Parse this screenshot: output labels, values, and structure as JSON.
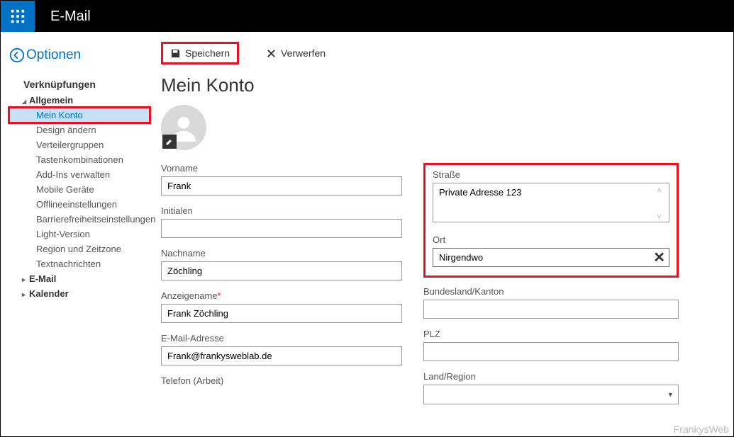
{
  "topbar": {
    "app_title": "E-Mail"
  },
  "back_label": "Optionen",
  "nav": {
    "heading": "Verknüpfungen",
    "group_allgemein": "Allgemein",
    "items_allgemein": {
      "mein_konto": "Mein Konto",
      "design": "Design ändern",
      "verteiler": "Verteilergruppen",
      "tasten": "Tastenkombinationen",
      "addins": "Add-Ins verwalten",
      "mobile": "Mobile Geräte",
      "offline": "Offlineeinstellungen",
      "barriere": "Barrierefreiheitseinstellungen",
      "light": "Light-Version",
      "region": "Region und Zeitzone",
      "text": "Textnachrichten"
    },
    "group_email": "E-Mail",
    "group_kalender": "Kalender"
  },
  "toolbar": {
    "save": "Speichern",
    "discard": "Verwerfen"
  },
  "page_title": "Mein Konto",
  "form": {
    "left": {
      "vorname_label": "Vorname",
      "vorname_value": "Frank",
      "initialen_label": "Initialen",
      "initialen_value": "",
      "nachname_label": "Nachname",
      "nachname_value": "Zöchling",
      "anzeigename_label": "Anzeigename",
      "anzeigename_value": "Frank Zöchling",
      "email_label": "E-Mail-Adresse",
      "email_value": "Frank@frankysweblab.de",
      "telefon_label": "Telefon (Arbeit)"
    },
    "right": {
      "strasse_label": "Straße",
      "strasse_value": "Private Adresse 123",
      "ort_label": "Ort",
      "ort_value": "Nirgendwo",
      "bundesland_label": "Bundesland/Kanton",
      "bundesland_value": "",
      "plz_label": "PLZ",
      "plz_value": "",
      "land_label": "Land/Region"
    }
  },
  "watermark": "FrankysWeb"
}
